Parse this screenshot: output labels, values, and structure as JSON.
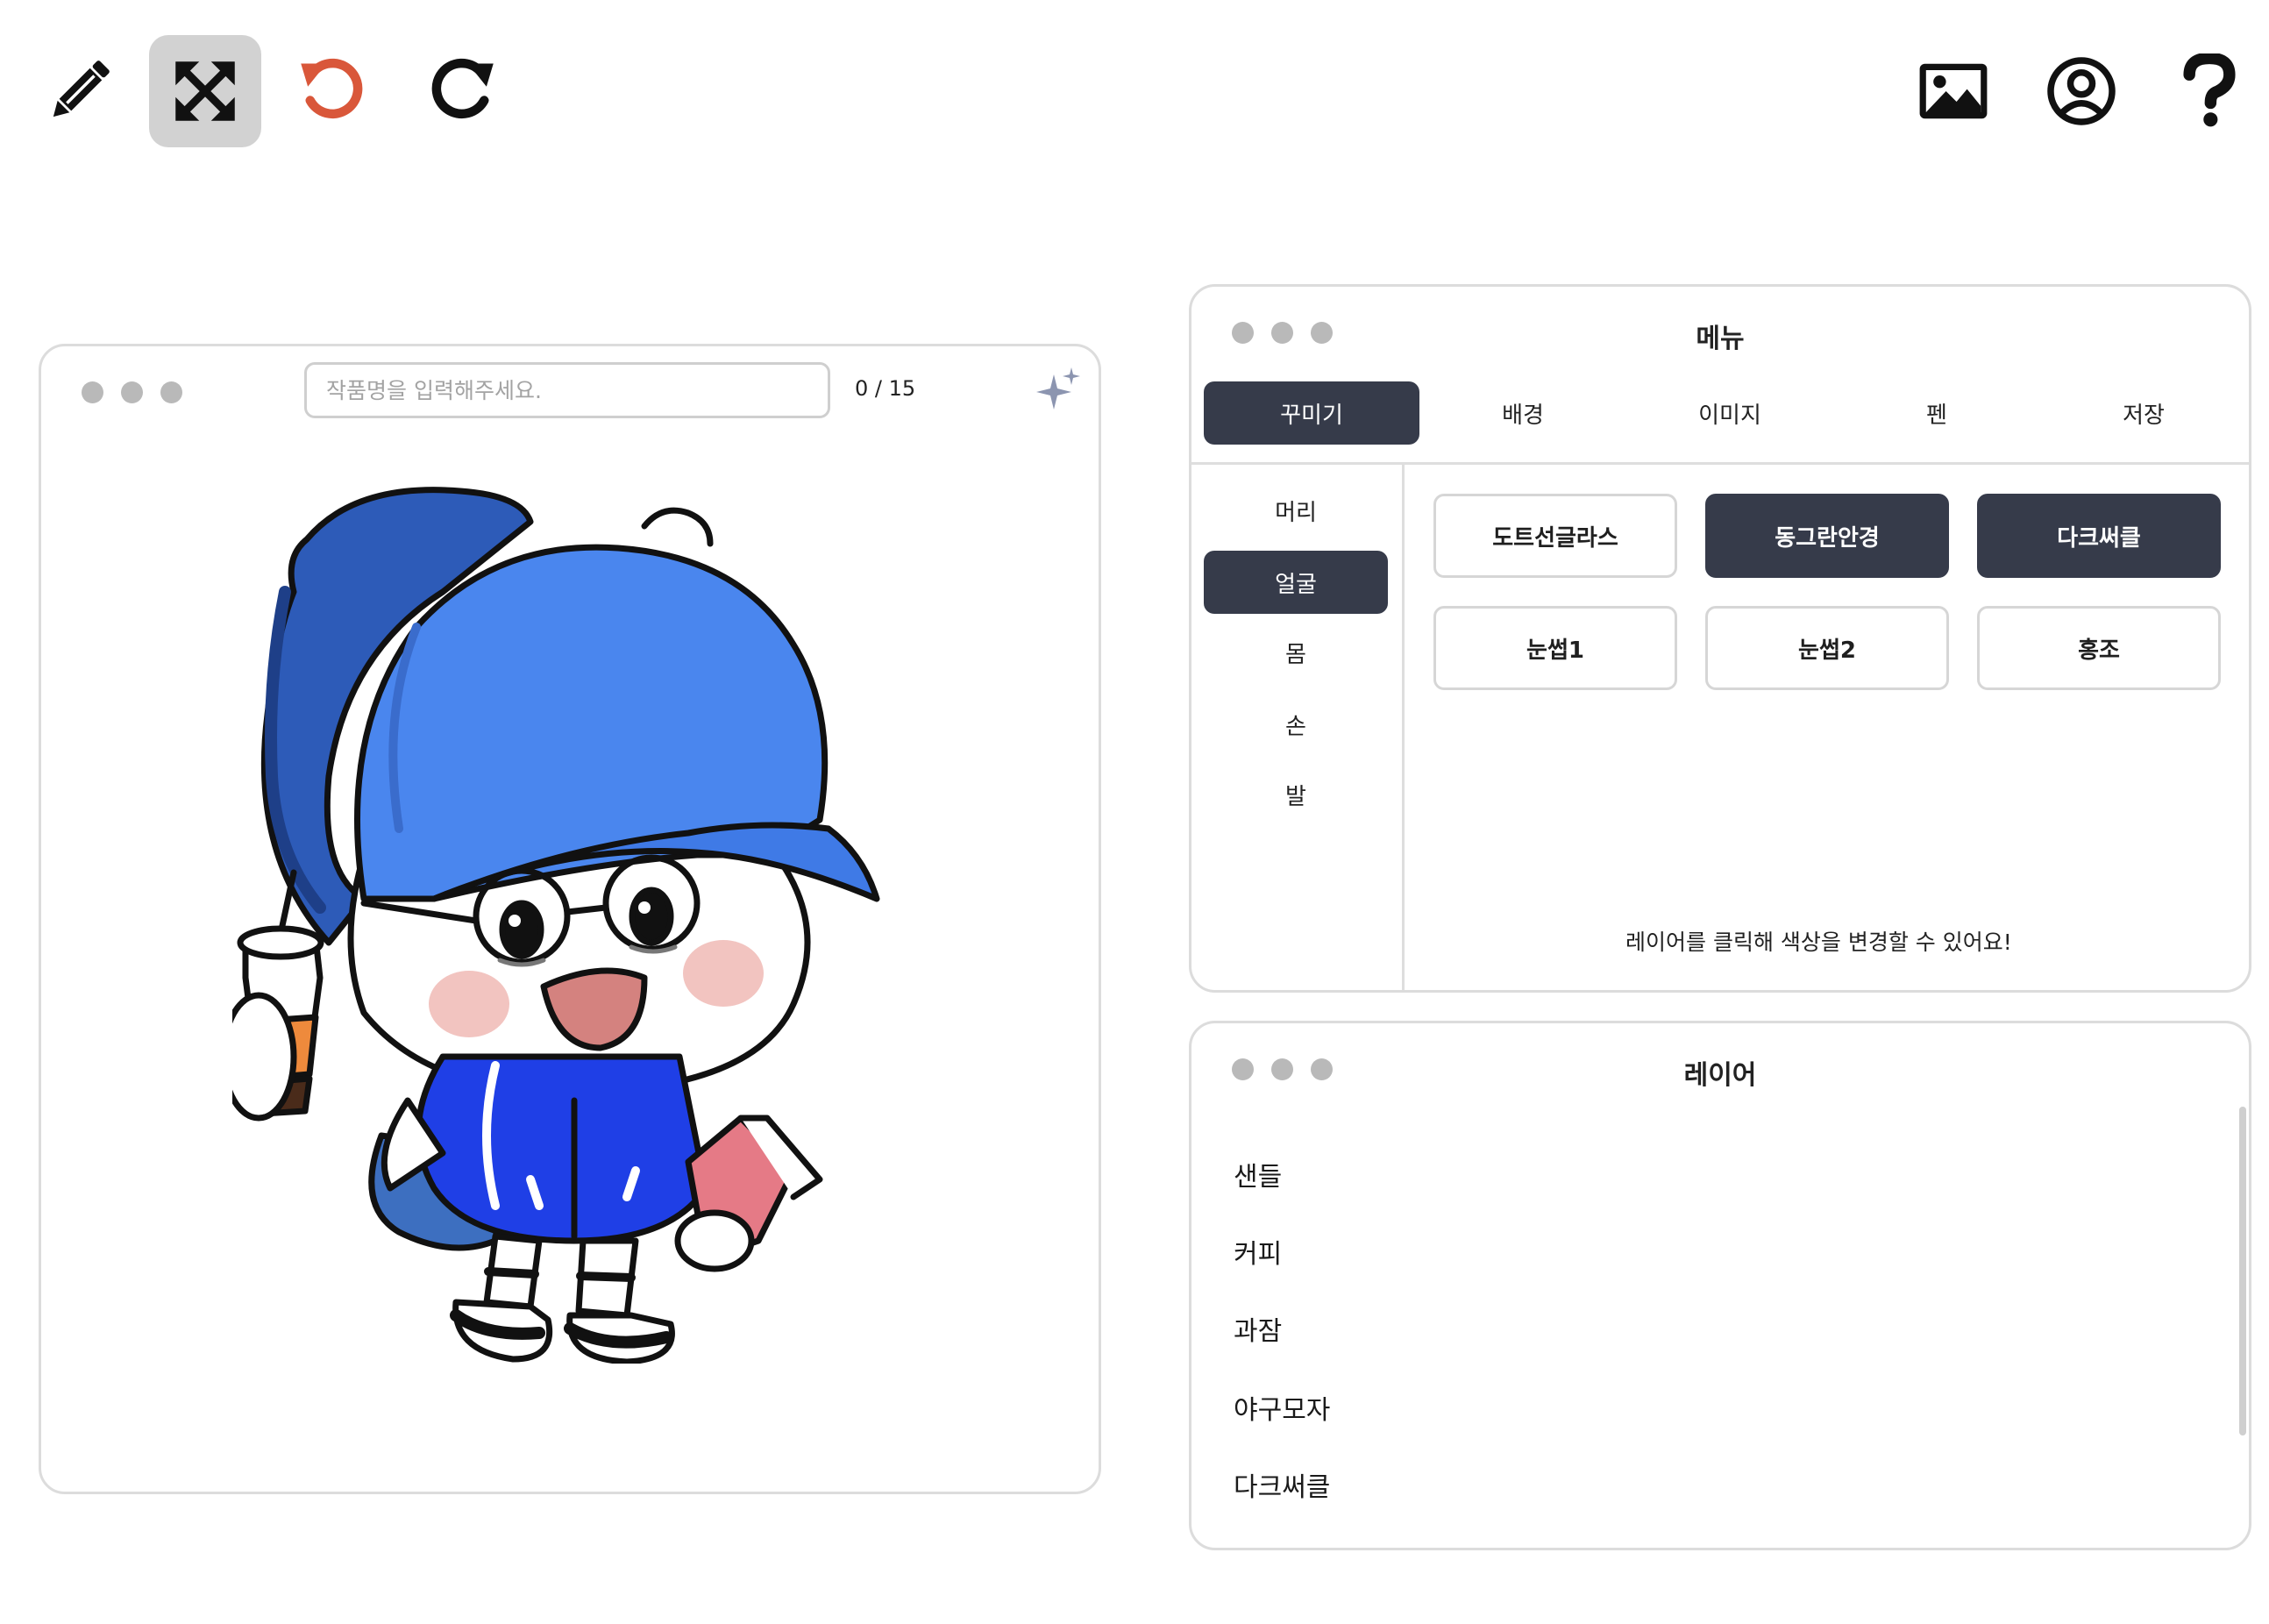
{
  "toolbar": {
    "left_tools": [
      {
        "icon": "pencil-icon",
        "active": false
      },
      {
        "icon": "move-arrows-icon",
        "active": true
      },
      {
        "icon": "undo-icon",
        "active": false,
        "color": "#d9573a"
      },
      {
        "icon": "redo-icon",
        "active": false
      }
    ],
    "right_tools": [
      {
        "icon": "image-icon"
      },
      {
        "icon": "user-icon"
      },
      {
        "icon": "question-icon"
      }
    ]
  },
  "canvas_window": {
    "title_placeholder": "작품명을 입력해주세요.",
    "title_value": "",
    "char_counter": "0 / 15",
    "sparkle_icon": "sparkle-icon",
    "character_colors": {
      "cap": "#4a86ee",
      "beanie": "#2d5bb8",
      "jacket": "#1f3fe6",
      "cheek": "#f2c4c0",
      "cup_sleeve": "#ee8a3c",
      "book": "#e57a86"
    }
  },
  "menu_window": {
    "title": "메뉴",
    "tabs": [
      {
        "label": "꾸미기",
        "active": true
      },
      {
        "label": "배경",
        "active": false
      },
      {
        "label": "이미지",
        "active": false
      },
      {
        "label": "펜",
        "active": false
      },
      {
        "label": "저장",
        "active": false
      }
    ],
    "categories": [
      {
        "label": "머리",
        "active": false
      },
      {
        "label": "얼굴",
        "active": true
      },
      {
        "label": "몸",
        "active": false
      },
      {
        "label": "손",
        "active": false
      },
      {
        "label": "발",
        "active": false
      }
    ],
    "options": [
      {
        "label": "도트선글라스",
        "active": false
      },
      {
        "label": "동그란안경",
        "active": true
      },
      {
        "label": "다크써클",
        "active": true
      },
      {
        "label": "눈썹1",
        "active": false
      },
      {
        "label": "눈썹2",
        "active": false
      },
      {
        "label": "홍조",
        "active": false
      }
    ],
    "hint": "레이어를 클릭해 색상을 변경할 수 있어요!"
  },
  "layer_window": {
    "title": "레이어",
    "layers": [
      "샌들",
      "커피",
      "과잠",
      "야구모자",
      "다크써클"
    ]
  },
  "colors": {
    "accent_dark": "#363b4a",
    "border": "#dcdcdc",
    "window_dot": "#b9b9b9"
  }
}
